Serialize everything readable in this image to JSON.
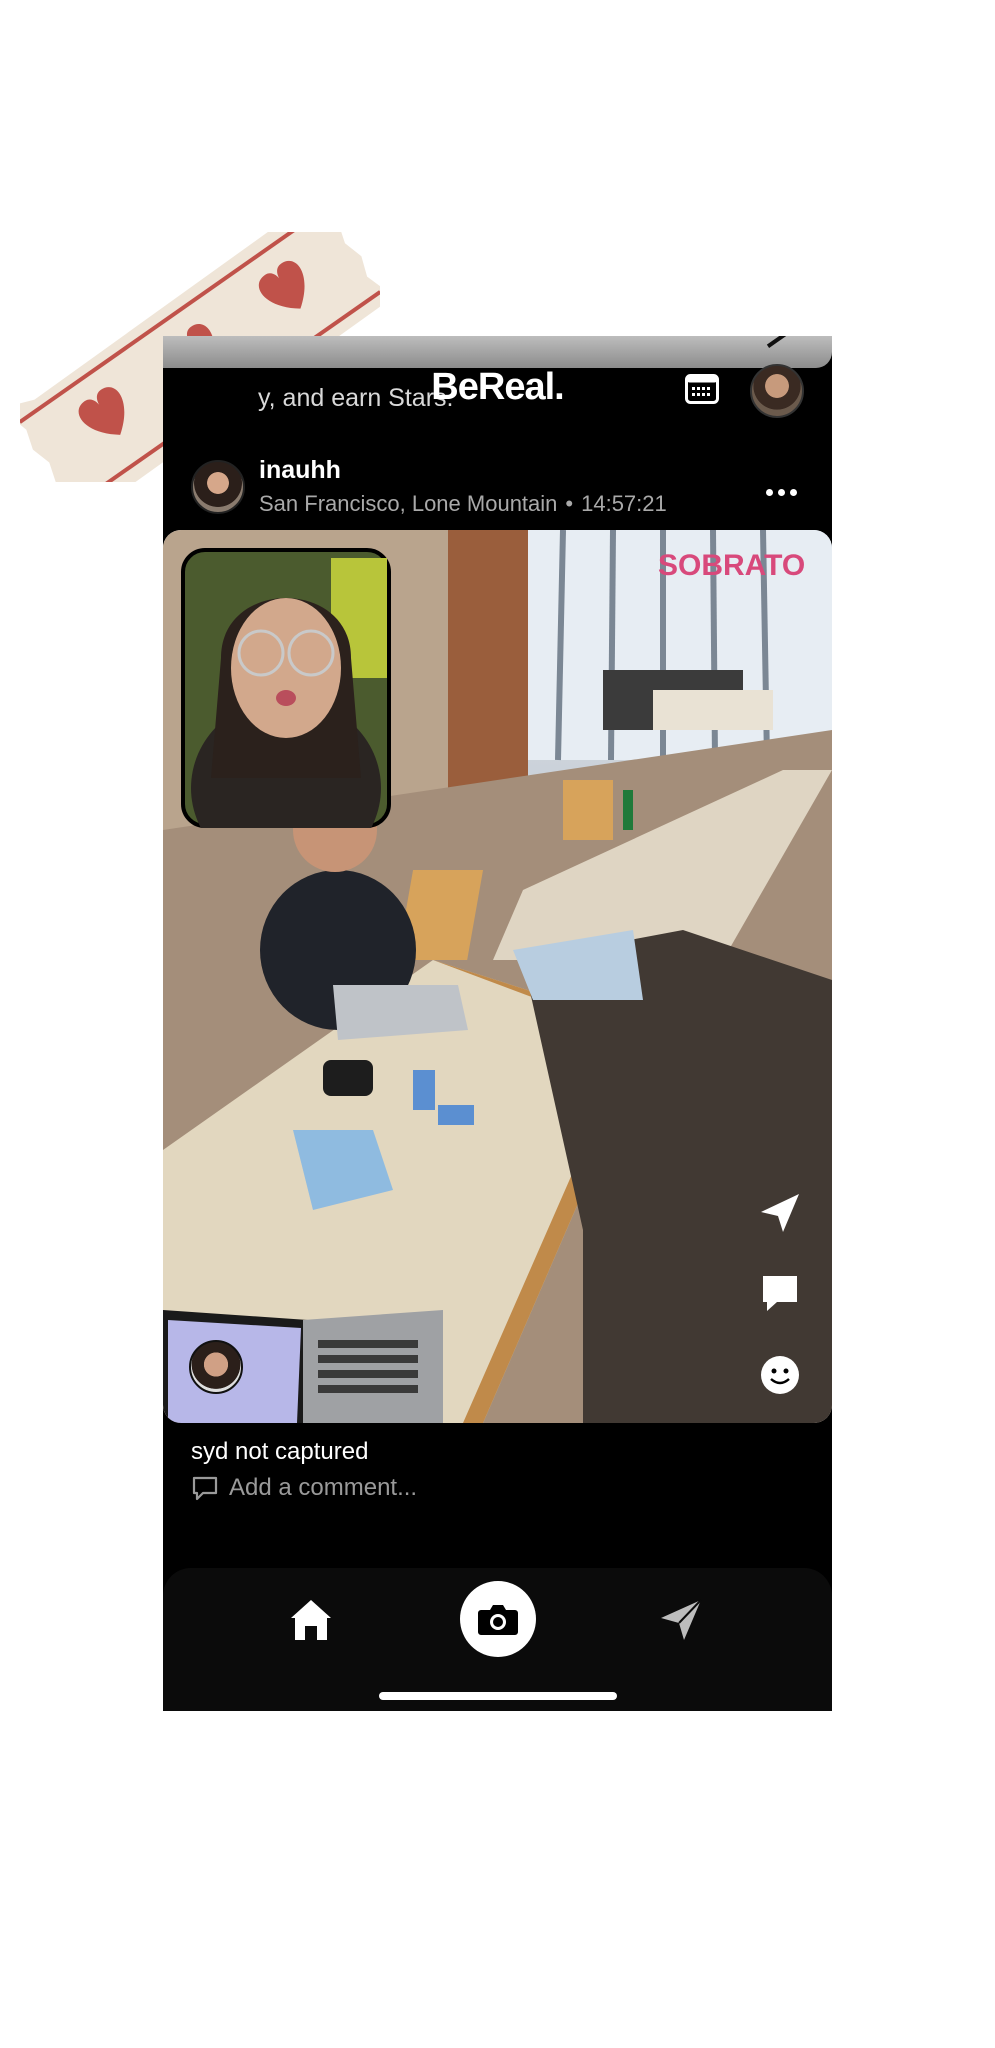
{
  "banner_text": "y, and earn Stars.",
  "app": {
    "logo": "BeReal."
  },
  "header": {
    "calendar_icon": "calendar-icon",
    "avatar": "profile-avatar"
  },
  "post": {
    "username": "inauhh",
    "location": "San Francisco, Lone Mountain",
    "separator": "•",
    "time": "14:57:21",
    "caption": "syd not captured",
    "comment_placeholder": "Add a comment..."
  },
  "actions": {
    "send_icon": "send-icon",
    "comment_icon": "comment-icon",
    "react_icon": "smiley-icon"
  },
  "nav": {
    "home_icon": "home-icon",
    "camera_icon": "camera-icon",
    "messages_icon": "send-icon"
  },
  "colors": {
    "background": "#000000",
    "tape": "#efe5d8",
    "tape_stripe": "#c0524a",
    "heart": "#c0524a"
  }
}
